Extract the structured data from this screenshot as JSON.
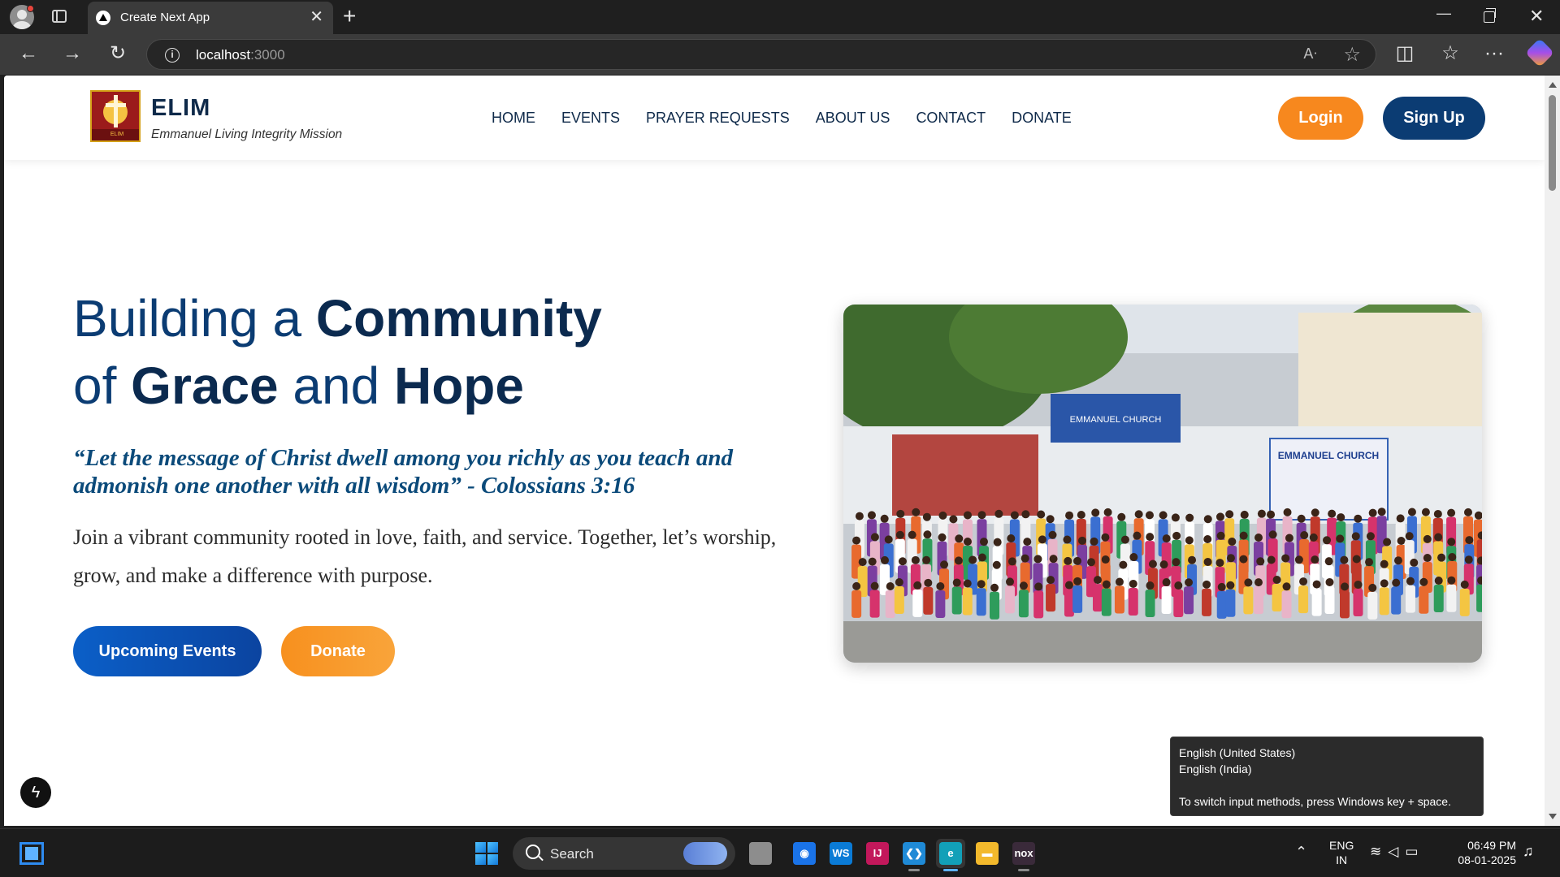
{
  "browser": {
    "tab_title": "Create Next App",
    "tab_close": "✕",
    "new_tab": "+",
    "url_host": "localhost",
    "url_port": ":3000",
    "window_minimize": "—",
    "window_close": "✕"
  },
  "site": {
    "brand_name": "ELIM",
    "brand_tagline": "Emmanuel Living Integrity Mission",
    "nav": [
      "HOME",
      "EVENTS",
      "PRAYER REQUESTS",
      "ABOUT US",
      "CONTACT",
      "DONATE"
    ],
    "login_label": "Login",
    "signup_label": "Sign Up",
    "logo_text": "ELIM"
  },
  "hero": {
    "title_line1_regular": "Building a ",
    "title_line1_bold": "Community",
    "title_line2_regular1": "of ",
    "title_line2_bold1": "Grace",
    "title_line2_regular2": " and ",
    "title_line2_bold2": "Hope",
    "verse": "“Let the message of Christ dwell among you richly as you teach and admonish one another with all wisdom” - Colossians 3:16",
    "description": "Join a vibrant community rooted in love, faith, and service. Together, let’s worship, grow, and make a difference with purpose.",
    "events_button": "Upcoming Events",
    "donate_button": "Donate",
    "photo_sign_main": "EMMANUEL CHURCH",
    "photo_banner": "EMMANUEL CHURCH"
  },
  "ime_tooltip": {
    "line1": "English (United States)",
    "line2": "English (India)",
    "hint": "To switch input methods, press Windows key + space."
  },
  "taskbar": {
    "search_label": "Search",
    "apps": [
      {
        "name": "Chrome",
        "glyph": "◉",
        "color": "#1a73e8"
      },
      {
        "name": "WebStorm",
        "glyph": "WS",
        "color": "#0a7bd6"
      },
      {
        "name": "IntelliJ IDEA",
        "glyph": "IJ",
        "color": "#c2185b"
      },
      {
        "name": "VS Code",
        "glyph": "❮❯",
        "color": "#1f8ad6"
      },
      {
        "name": "Edge",
        "glyph": "e",
        "color": "#12a0b8"
      },
      {
        "name": "File Explorer",
        "glyph": "▬",
        "color": "#f3b92c"
      },
      {
        "name": "Nox",
        "glyph": "nox",
        "color": "#3a2a3a"
      }
    ],
    "lang_top": "ENG",
    "lang_bottom": "IN",
    "time": "06:49 PM",
    "date": "08-01-2025"
  },
  "colors": {
    "brand_navy": "#0b3c73",
    "accent_orange": "#f7881e"
  }
}
